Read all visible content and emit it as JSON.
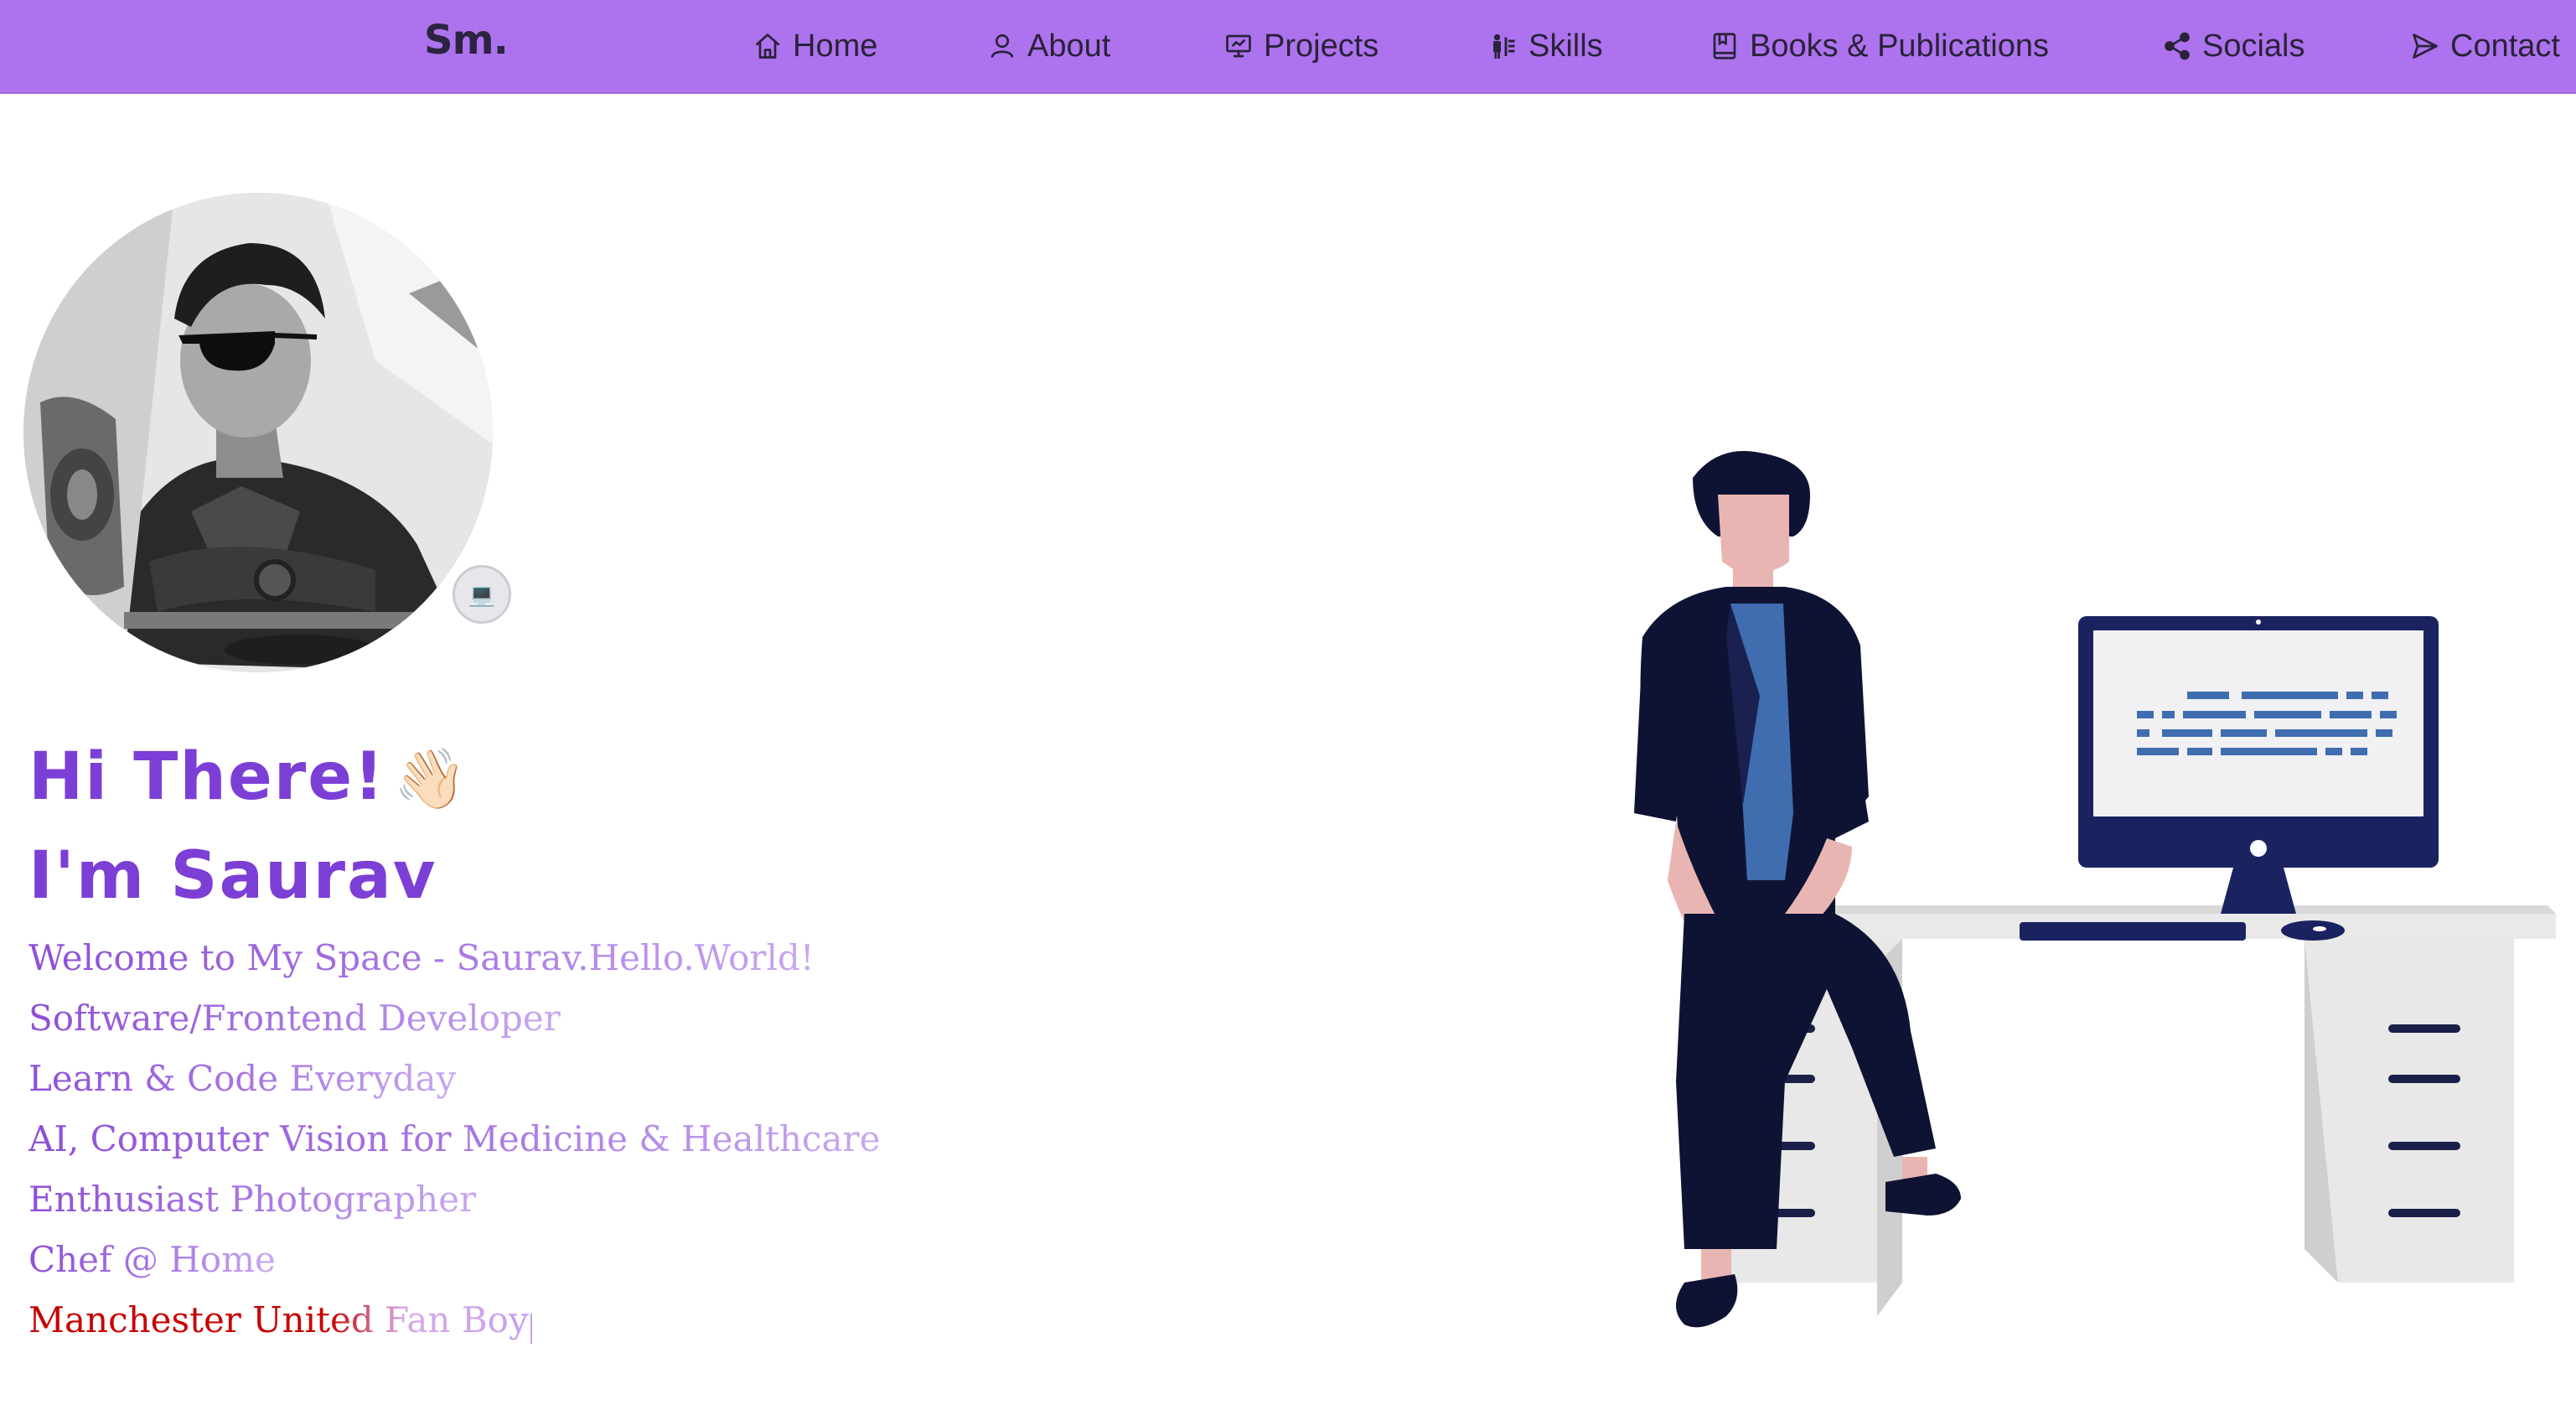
{
  "nav": {
    "logo": "Sm.",
    "items": [
      {
        "label": "Home",
        "icon": "home-icon"
      },
      {
        "label": "About",
        "icon": "user-icon"
      },
      {
        "label": "Projects",
        "icon": "presentation-icon"
      },
      {
        "label": "Skills",
        "icon": "skills-icon"
      },
      {
        "label": "Books & Publications",
        "icon": "book-icon"
      },
      {
        "label": "Socials",
        "icon": "share-icon"
      },
      {
        "label": "Contact",
        "icon": "send-icon"
      }
    ]
  },
  "hero": {
    "greeting_line1": "Hi There!",
    "wave_emoji": "👋🏻",
    "greeting_line2": "I'm Saurav",
    "taglines": [
      "Welcome to My Space - Saurav.Hello.World!",
      "Software/Frontend Developer",
      "Learn & Code Everyday",
      "AI, Computer Vision for Medicine & Healthcare",
      "Enthusiast Photographer",
      "Chef @ Home",
      "Manchester United Fan Boy"
    ]
  },
  "colors": {
    "navbar_bg": "#ad73ee",
    "accent_purple": "#7c3fd6",
    "manutd_red": "#c80000",
    "illustration_navy": "#0f1333",
    "illustration_blue": "#3f6db0"
  }
}
